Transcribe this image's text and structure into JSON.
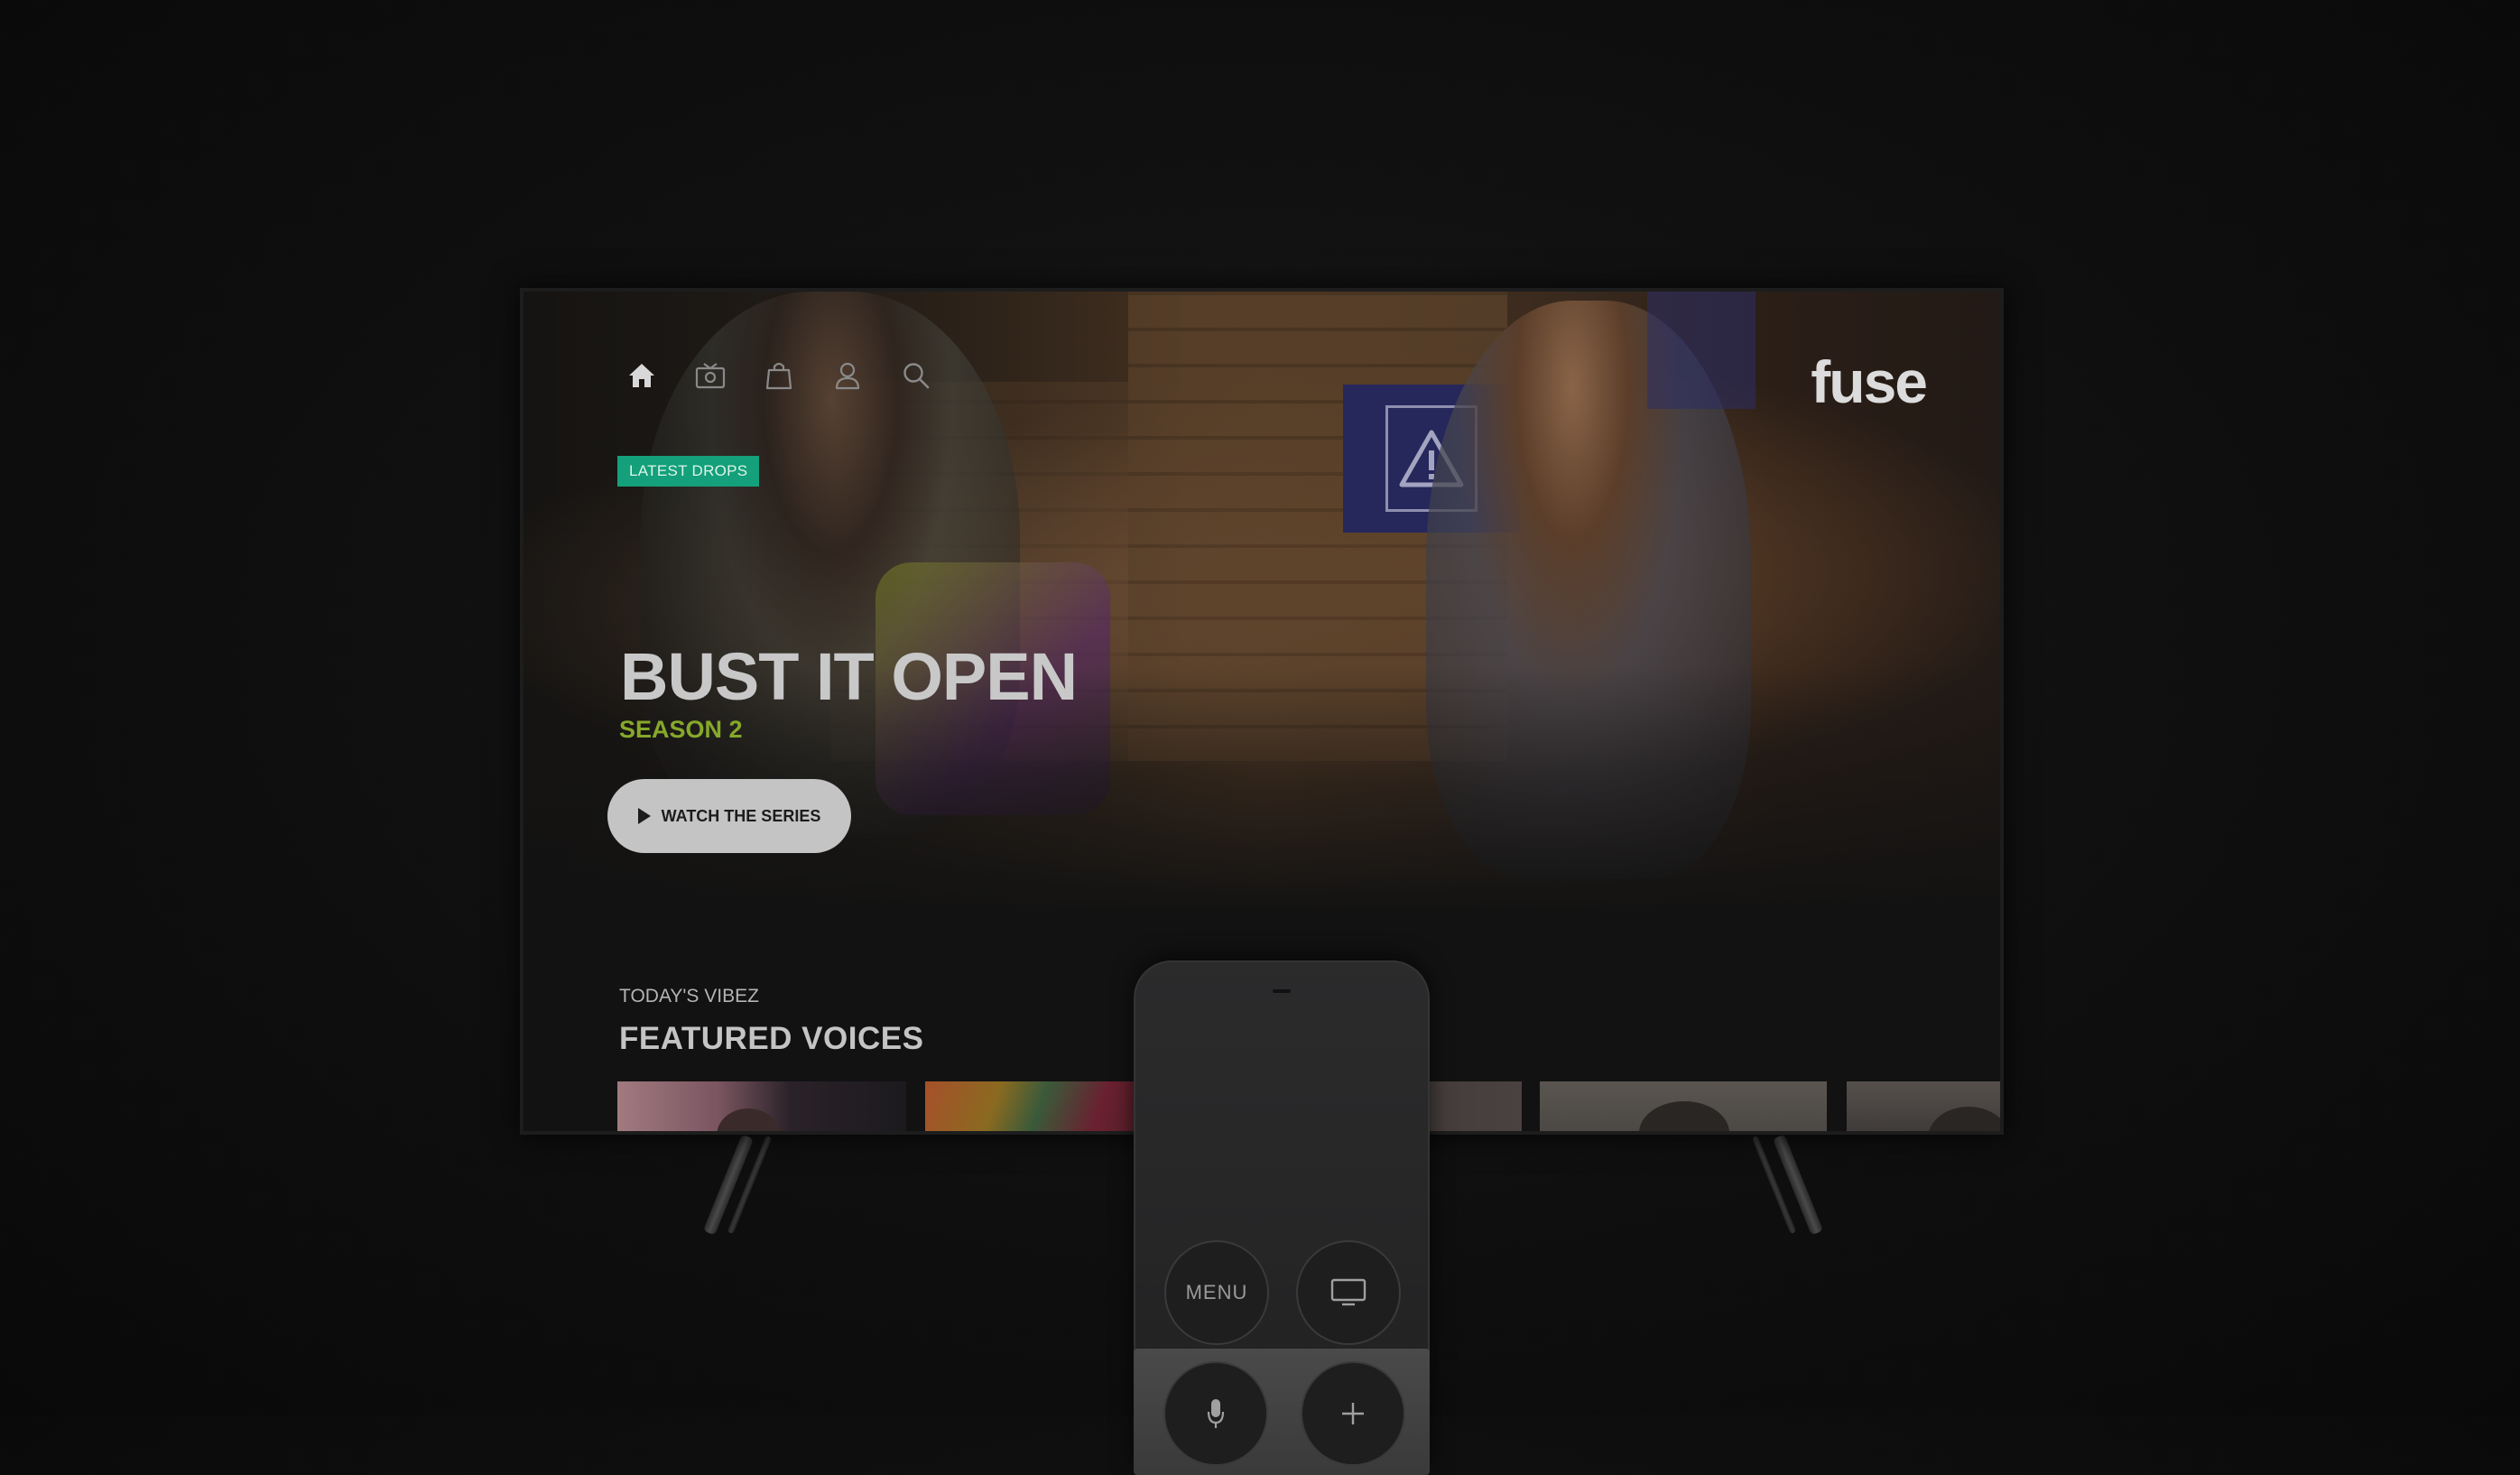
{
  "nav": {
    "items": [
      {
        "name": "home",
        "icon": "home-icon",
        "active": true
      },
      {
        "name": "live",
        "icon": "tv-camera-icon",
        "active": false
      },
      {
        "name": "shop",
        "icon": "shopping-bag-icon",
        "active": false
      },
      {
        "name": "profile",
        "icon": "user-icon",
        "active": false
      },
      {
        "name": "search",
        "icon": "search-icon",
        "active": false
      }
    ]
  },
  "brand": {
    "logo_text": "fuse"
  },
  "hero": {
    "badge": "LATEST DROPS",
    "title": "BUST IT OPEN",
    "subtitle": "SEASON 2",
    "cta_label": "WATCH THE SERIES",
    "badge_color": "#13a07a",
    "subtitle_color": "#86a92a"
  },
  "row": {
    "kicker": "TODAY'S VIBEZ",
    "title": "FEATURED VOICES"
  },
  "remote": {
    "menu_label": "MENU",
    "tv_icon": "tv-icon",
    "mic_icon": "microphone-icon",
    "volume_icon": "plus-icon"
  }
}
